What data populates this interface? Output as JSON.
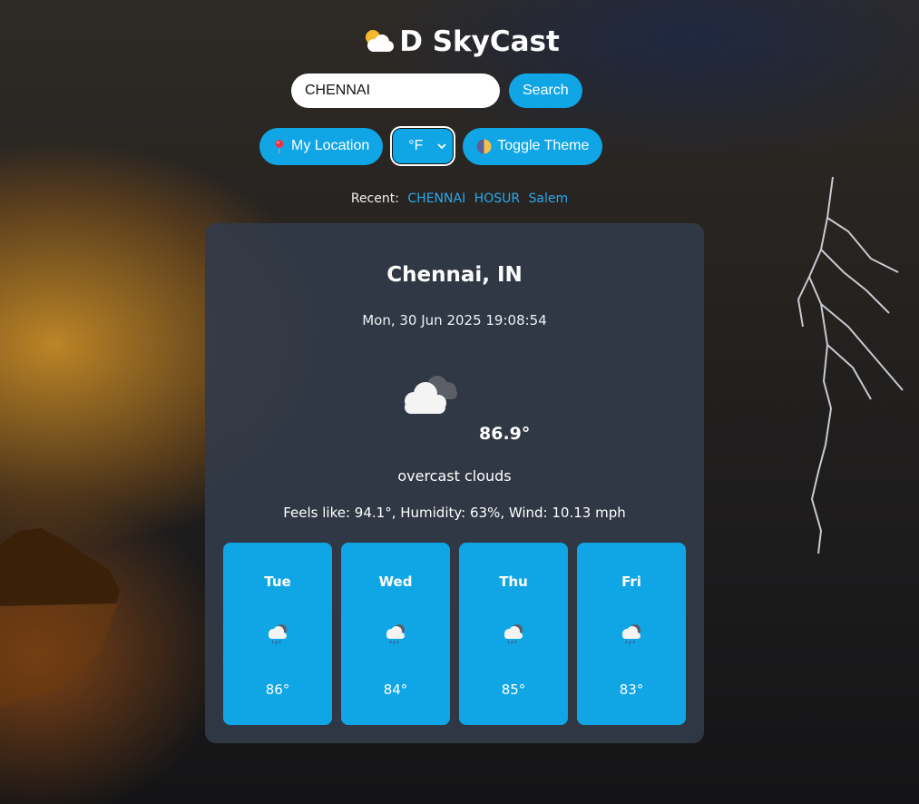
{
  "header": {
    "title": "D SkyCast",
    "logo_icon": "sun-behind-cloud-icon"
  },
  "search": {
    "value": "CHENNAI",
    "button_label": "Search"
  },
  "controls": {
    "location_label": "My Location",
    "location_icon": "pin-icon",
    "unit_selected": "°F",
    "theme_label": "Toggle Theme",
    "theme_icon": "half-moon-icon"
  },
  "recent": {
    "label": "Recent:",
    "items": [
      "CHENNAI",
      "HOSUR",
      "Salem"
    ]
  },
  "weather": {
    "city": "Chennai, IN",
    "datetime": "Mon, 30 Jun 2025 19:08:54",
    "icon": "overcast-clouds-icon",
    "temperature": "86.9°",
    "description": "overcast clouds",
    "details": "Feels like: 94.1°, Humidity: 63%, Wind: 10.13 mph"
  },
  "forecast": [
    {
      "day": "Tue",
      "temp": "86°",
      "icon": "rain-cloud-icon"
    },
    {
      "day": "Wed",
      "temp": "84°",
      "icon": "rain-cloud-icon"
    },
    {
      "day": "Thu",
      "temp": "85°",
      "icon": "rain-cloud-icon"
    },
    {
      "day": "Fri",
      "temp": "83°",
      "icon": "rain-cloud-icon"
    }
  ],
  "colors": {
    "accent": "#10a6e6",
    "card_bg": "#323a48",
    "link": "#29a9ef"
  }
}
